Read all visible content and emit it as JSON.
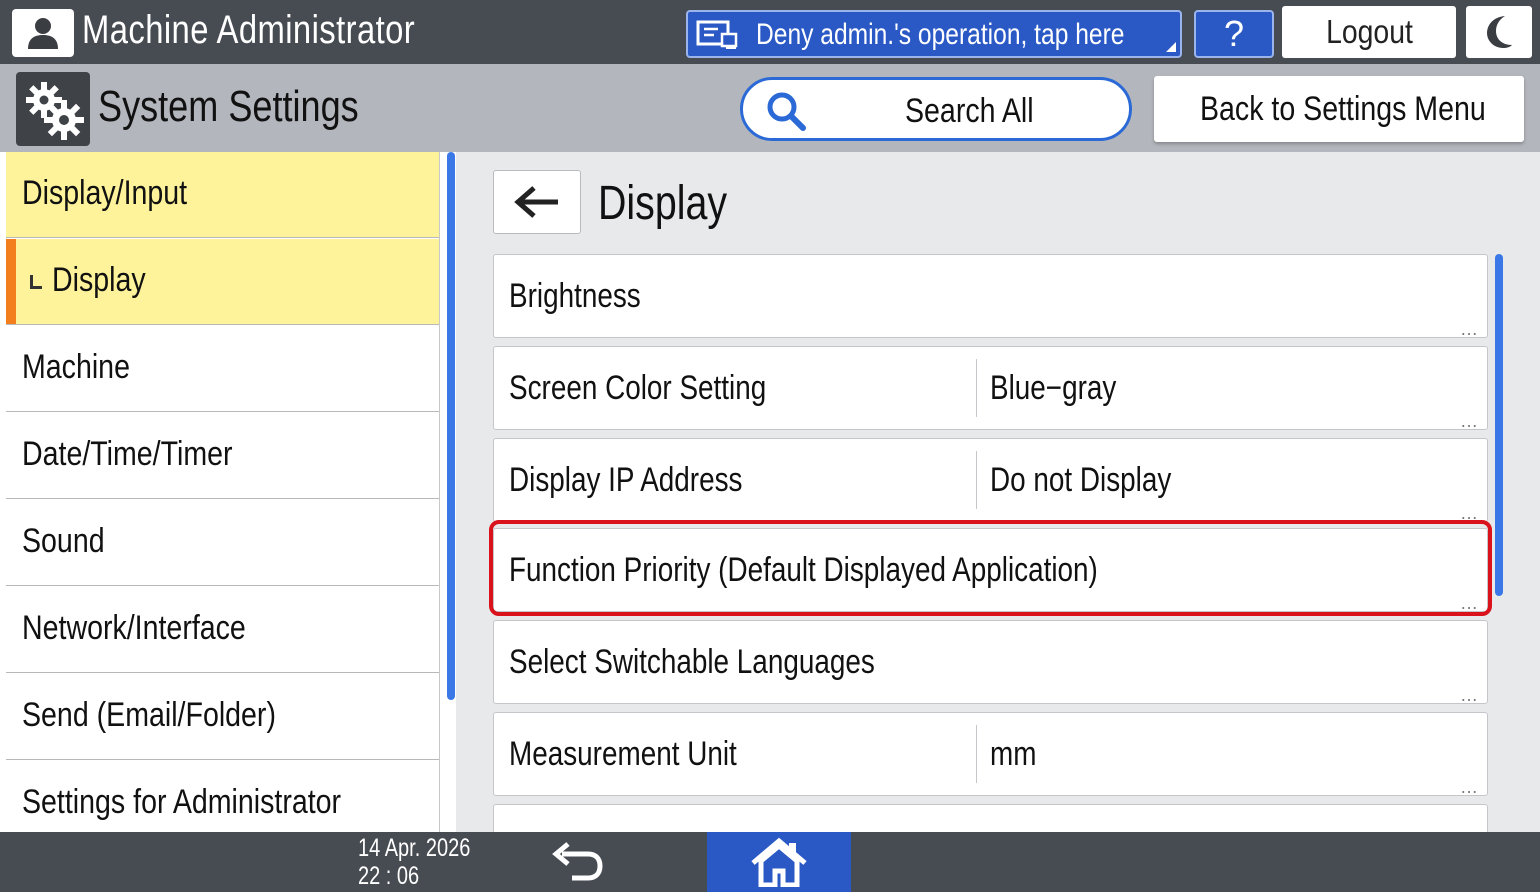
{
  "topbar": {
    "user_title": "Machine Administrator",
    "deny_label": "Deny admin.'s operation, tap here",
    "help_label": "?",
    "logout_label": "Logout"
  },
  "header": {
    "section_title": "System Settings",
    "search_label": "Search All",
    "back_menu_label": "Back to Settings Menu"
  },
  "sidebar": {
    "items": [
      {
        "label": "Display/Input"
      },
      {
        "label": "Display"
      },
      {
        "label": "Machine"
      },
      {
        "label": "Date/Time/Timer"
      },
      {
        "label": "Sound"
      },
      {
        "label": "Network/Interface"
      },
      {
        "label": "Send (Email/Folder)"
      },
      {
        "label": "Settings for Administrator"
      }
    ]
  },
  "main": {
    "title": "Display",
    "rows": [
      {
        "label": "Brightness",
        "value": ""
      },
      {
        "label": "Screen Color Setting",
        "value": "Blue−gray"
      },
      {
        "label": "Display IP Address",
        "value": "Do not Display"
      },
      {
        "label": "Function Priority (Default Displayed Application)",
        "value": ""
      },
      {
        "label": "Select Switchable Languages",
        "value": ""
      },
      {
        "label": "Measurement Unit",
        "value": "mm"
      }
    ],
    "more_dots": "…"
  },
  "statusbar": {
    "date": "14 Apr. 2026",
    "time": "22 : 06"
  },
  "colors": {
    "topbar": "#474b52",
    "accent_blue": "#2a59c6",
    "active_nav": "#fef39a",
    "active_marker": "#f27f1b",
    "highlight_red": "#d9121b"
  }
}
